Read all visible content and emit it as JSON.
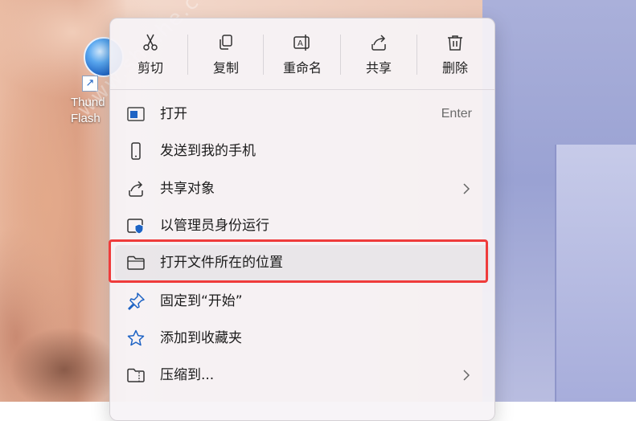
{
  "desktop": {
    "shortcut_label": "Thund\nFlash",
    "watermark": "www.shuihe.c"
  },
  "context_menu": {
    "toolbar": [
      {
        "label": "剪切",
        "icon": "scissors-icon"
      },
      {
        "label": "复制",
        "icon": "copy-icon"
      },
      {
        "label": "重命名",
        "icon": "rename-icon"
      },
      {
        "label": "共享",
        "icon": "share-icon"
      },
      {
        "label": "删除",
        "icon": "trash-icon"
      }
    ],
    "items": [
      {
        "label": "打开",
        "shortcut": "Enter",
        "icon": "open-window-icon"
      },
      {
        "label": "发送到我的手机",
        "icon": "phone-icon"
      },
      {
        "label": "共享对象",
        "icon": "share-icon",
        "submenu": true
      },
      {
        "label": "以管理员身份运行",
        "icon": "admin-shield-icon"
      },
      {
        "label": "打开文件所在的位置",
        "icon": "folder-icon",
        "highlighted": true
      },
      {
        "label": "固定到“开始”",
        "icon": "pin-icon"
      },
      {
        "label": "添加到收藏夹",
        "icon": "star-icon"
      },
      {
        "label": "压缩到...",
        "icon": "zip-folder-icon",
        "submenu": true
      }
    ]
  },
  "colors": {
    "accent": "#1e63c4",
    "highlight_border": "#ef3b3b"
  }
}
